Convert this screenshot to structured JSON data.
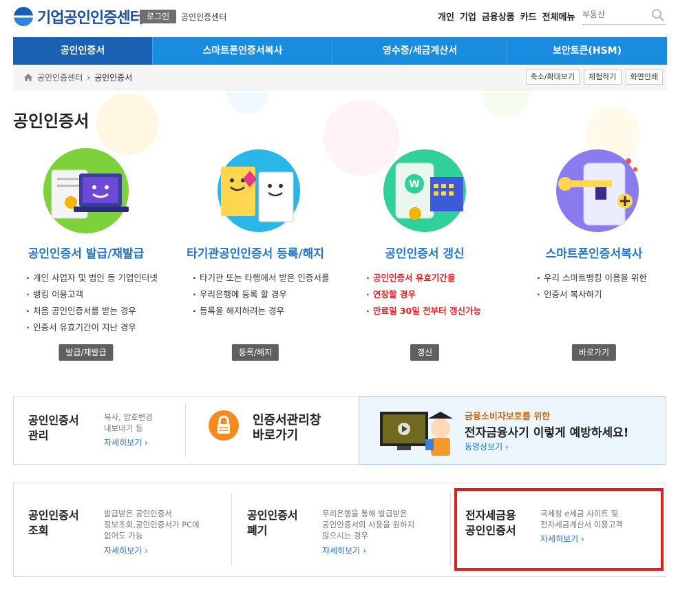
{
  "header": {
    "logo_text": "기업공인인증센터",
    "login_label": "로그인",
    "site_name": "공인인증센터",
    "topnav": [
      "개인",
      "기업",
      "금융상품",
      "카드",
      "전체메뉴"
    ],
    "search_placeholder": "부동산"
  },
  "menu": [
    "공인인증서",
    "스마트폰인증서복사",
    "영수증/세금계산서",
    "보안토큰(HSM)"
  ],
  "breadcrumb": {
    "home": "공인인증센터",
    "current": "공인인증서"
  },
  "tools": [
    "축소/확대보기",
    "체험하기",
    "화면인쇄"
  ],
  "page_title": "공인인증서",
  "services": [
    {
      "title": "공인인증서 발급/재발급",
      "items": [
        "개인 사업자 및 법인 등 기업인터넷",
        "뱅킹 이용고객",
        "처음 공인인증서를 받는 경우",
        "인증서 유효기간이 지난 경우"
      ],
      "button": "발급/재발급"
    },
    {
      "title": "타기관공인인증서 등록/해지",
      "items": [
        "타기관 또는 타행에서 받은 인증서를",
        "우리은행에 등록 할 경우",
        "등록을 해지하려는 경우"
      ],
      "button": "등록/해지"
    },
    {
      "title": "공인인증서 갱신",
      "items": [
        "공인인증서 유효기간을",
        "연장할 경우",
        "만료일 30일 전부터 갱신가능"
      ],
      "button": "갱신"
    },
    {
      "title": "스마트폰인증서복사",
      "items": [
        "우리 스마트뱅킹 이용을 위한",
        "인증서 복사하기"
      ],
      "button": "바로가기"
    }
  ],
  "manage_box": {
    "title_line1": "공인인증서",
    "title_line2": "관리",
    "desc_line1": "복사, 암호변경",
    "desc_line2": "내보내기 등",
    "link": "자세히보기 ›"
  },
  "window_box": {
    "title_line1": "인증서관리창",
    "title_line2": "바로가기"
  },
  "promo_box": {
    "sub": "금융소비자보호를 위한",
    "main": "전자금융사기 이렇게 예방하세요!",
    "link": "동영상보기 ›"
  },
  "lookup_box": {
    "title_line1": "공인인증서",
    "title_line2": "조회",
    "desc_line1": "발급받은 공인인증서",
    "desc_line2": "정보조회,공인인증서가 PC에",
    "desc_line3": "없어도 가능",
    "link": "자세히보기 ›"
  },
  "revoke_box": {
    "title_line1": "공인인증서",
    "title_line2": "폐기",
    "desc_line1": "우리은행을 통해 발급받은",
    "desc_line2": "공인인증서의 사용을 원하지",
    "desc_line3": "않으시는 경우",
    "link": "자세히보기 ›"
  },
  "tax_box": {
    "title_line1": "전자세금용",
    "title_line2": "공인인증서",
    "desc_line1": "국세청 e세금 사이트 및",
    "desc_line2": "전자세금계산서 이용고객",
    "link": "자세히보기 ›"
  },
  "colors": {
    "brand_blue": "#1a8ce0",
    "active_menu": "#1c62b4",
    "highlight_red": "#e21b1b"
  }
}
